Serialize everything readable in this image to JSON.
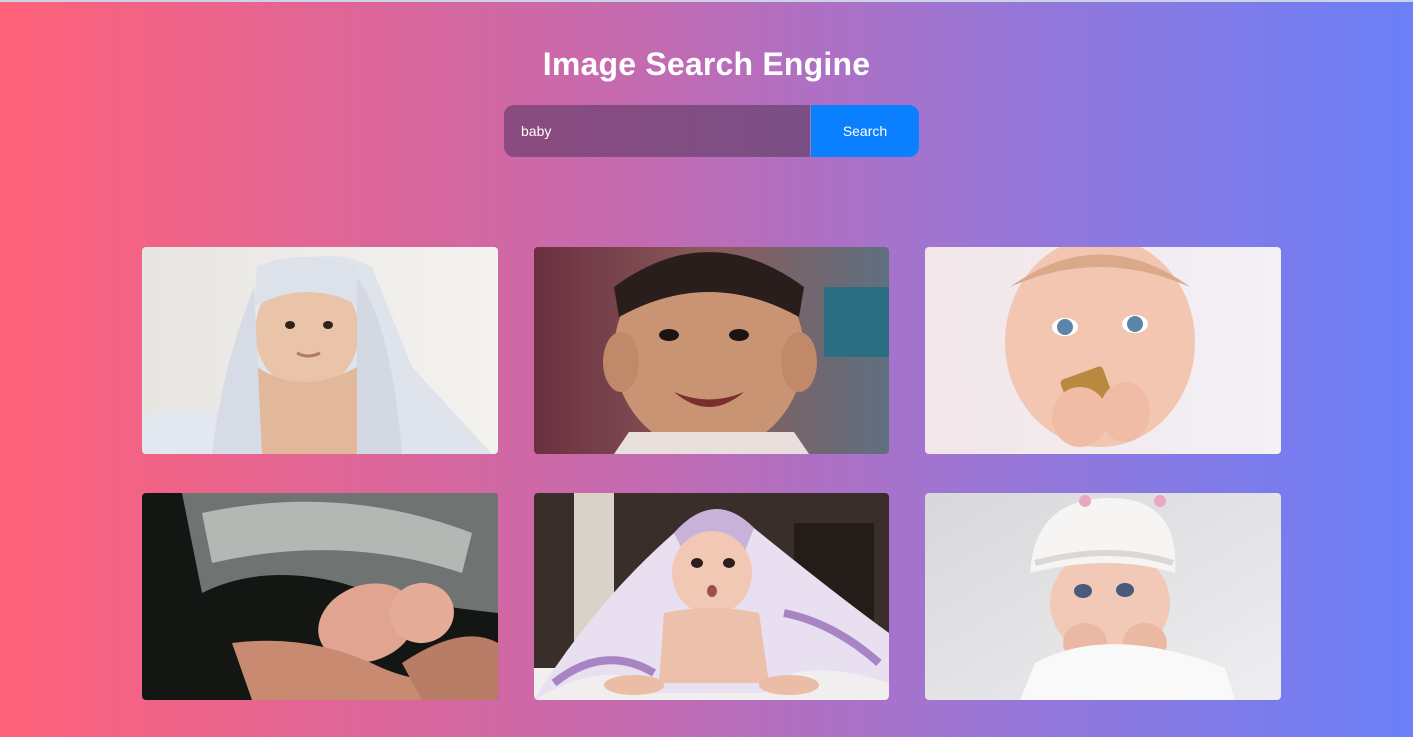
{
  "app": {
    "title": "Image Search Engine"
  },
  "search": {
    "value": "baby",
    "button_label": "Search"
  },
  "results": [
    {
      "alt": "baby"
    },
    {
      "alt": "baby"
    },
    {
      "alt": "baby"
    },
    {
      "alt": "baby"
    },
    {
      "alt": "baby"
    },
    {
      "alt": "baby"
    }
  ],
  "colors": {
    "gradient_start": "#ff6179",
    "gradient_end": "#6a7ff8",
    "button": "#0a80ff",
    "title_text": "#ffffff"
  }
}
